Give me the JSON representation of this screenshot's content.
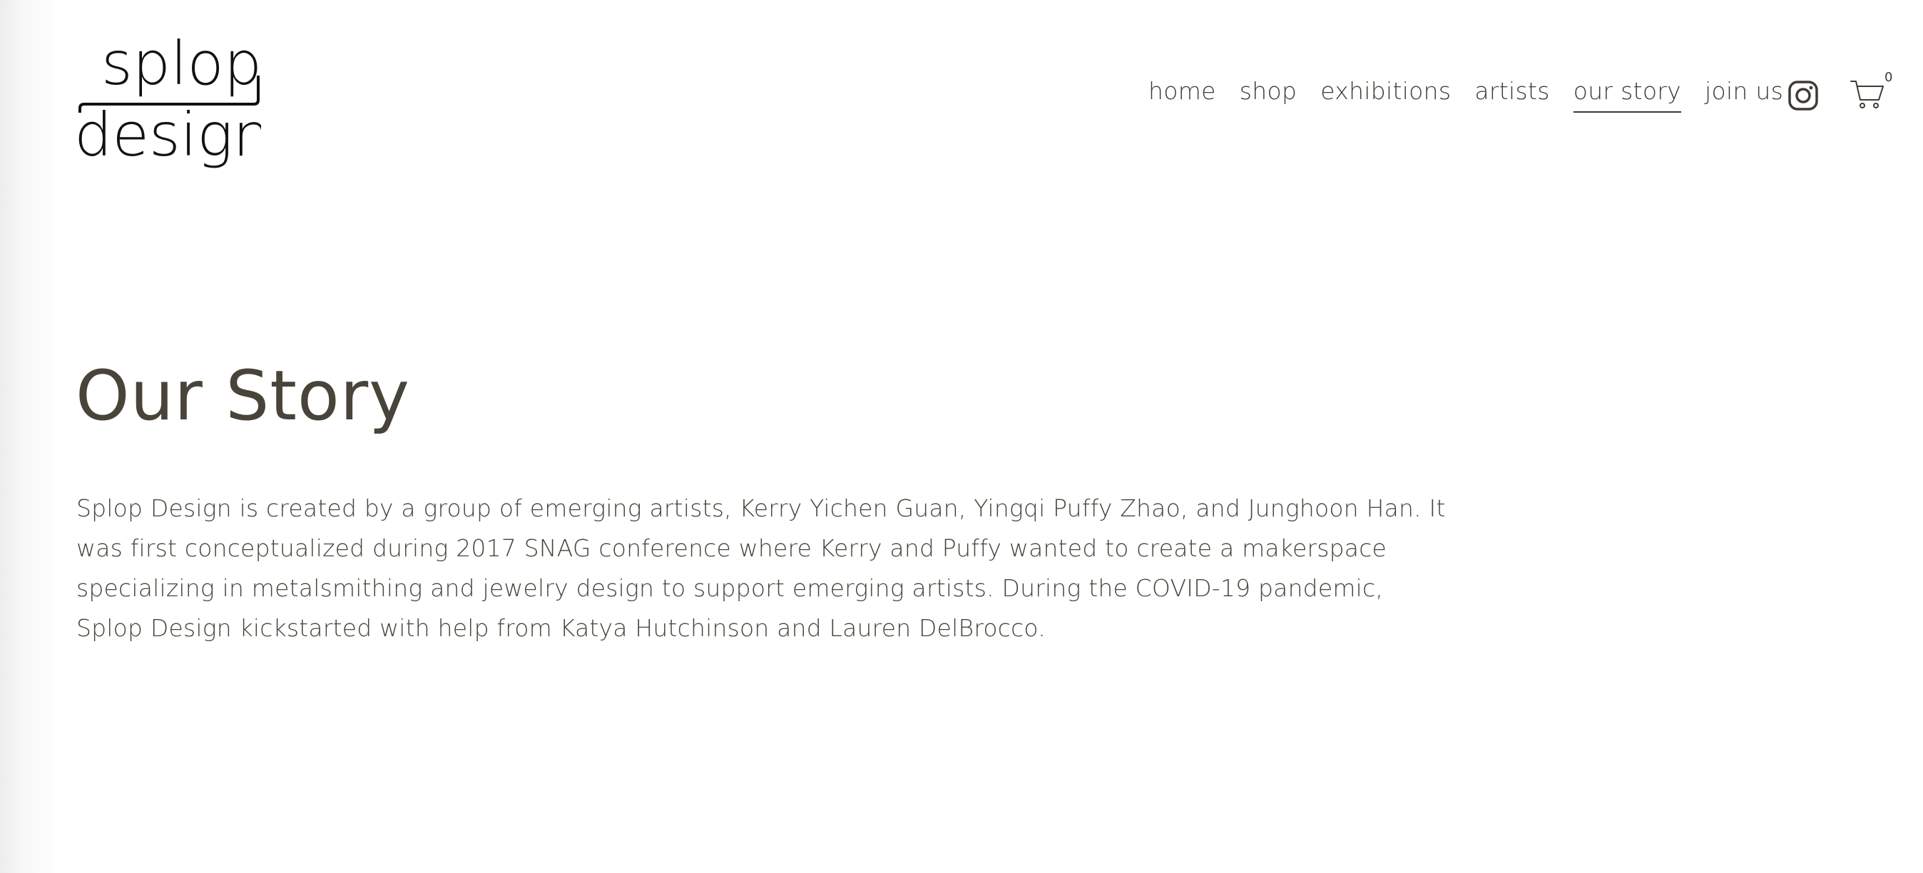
{
  "brand": {
    "logo_line1": "splop",
    "logo_line2": "design"
  },
  "nav": {
    "items": [
      {
        "label": "home",
        "active": false
      },
      {
        "label": "shop",
        "active": false
      },
      {
        "label": "exhibitions",
        "active": false
      },
      {
        "label": "artists",
        "active": false
      },
      {
        "label": "our story",
        "active": true
      },
      {
        "label": "join us",
        "active": false
      }
    ],
    "instagram_icon": "instagram-icon",
    "cart_icon": "cart-icon",
    "cart_count": "0"
  },
  "main": {
    "title": "Our Story",
    "paragraph": "Splop Design is created by a group of emerging artists, Kerry Yichen Guan, Yingqi Puffy Zhao, and Junghoon Han. It was first conceptualized during 2017 SNAG conference where Kerry and Puffy wanted to create a makerspace specializing in metalsmithing and jewelry design to support emerging artists. During the COVID-19 pandemic, Splop Design kickstarted with help from Katya Hutchinson and Lauren DelBrocco."
  },
  "colors": {
    "text": "#48443a",
    "nav_text": "#3f3b33",
    "logo": "#111111",
    "background": "#ffffff"
  }
}
